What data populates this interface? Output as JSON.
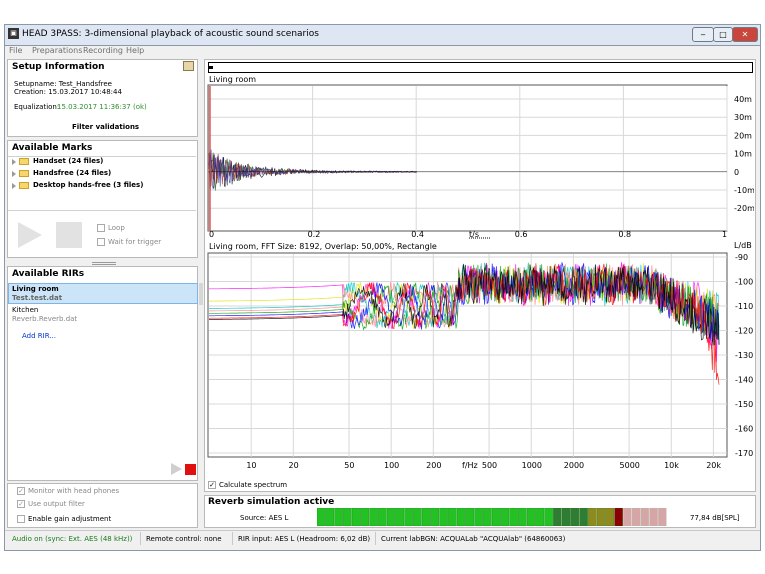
{
  "window": {
    "title": "HEAD 3PASS: 3-dimensional playback of acoustic sound scenarios",
    "app_icon": "bmp-icon",
    "controls": {
      "minimize": "‒",
      "maximize": "□",
      "close": "✕"
    }
  },
  "menu": [
    "File",
    "Preparations",
    "Recording",
    "Help"
  ],
  "setup": {
    "header": "Setup Information",
    "setupname": "Setupname: Test_Handsfree",
    "creation": "Creation: 15.03.2017 10:48:44",
    "equalization_label": "Equalization:",
    "equalization_value": "15.03.2017 11:36:37 (ok)",
    "filter_validations": "Filter validations"
  },
  "marks": {
    "header": "Available Marks",
    "items": [
      "Handset (24 files)",
      "Handsfree (24 files)",
      "Desktop hands-free (3 files)"
    ],
    "loop": "Loop",
    "wait_for_trigger": "Wait for trigger"
  },
  "rirs": {
    "header": "Available RIRs",
    "items": [
      {
        "name": "Living room",
        "file": "Test.test.dat"
      },
      {
        "name": "Kitchen",
        "file": "Reverb.Reverb.dat"
      }
    ],
    "add": "Add RIR..."
  },
  "bottom_options": {
    "monitor": "Monitor with head phones",
    "output_filter": "Use output filter",
    "gain": "Enable gain adjustment"
  },
  "time_chart": {
    "title": "Living room",
    "xlabel": "t/s",
    "xticks": [
      "0",
      "0.2",
      "0.4",
      "0.6",
      "0.8",
      "1"
    ],
    "yticks": [
      "40m",
      "30m",
      "20m",
      "10m",
      "0",
      "-10m",
      "-20m"
    ]
  },
  "spectrum_chart": {
    "title": "Living room, FFT Size: 8192, Overlap: 50,00%, Rectangle",
    "ylabel": "L/dB",
    "xlabel": "f/Hz",
    "xticks": [
      "10",
      "20",
      "50",
      "100",
      "200",
      "500",
      "1000",
      "2000",
      "5000",
      "10k",
      "20k"
    ],
    "yticks": [
      "-90",
      "-100",
      "-110",
      "-120",
      "-130",
      "-140",
      "-150",
      "-160",
      "-170"
    ]
  },
  "calculate_spectrum": "Calculate spectrum",
  "reverb": {
    "title": "Reverb simulation active",
    "source": "Source: AES L",
    "level": "77,84 dB[SPL]",
    "meter_fraction": 0.87
  },
  "status": {
    "audio": "Audio on (sync: Ext. AES (48 kHz))",
    "remote": "Remote control: none",
    "rir_input": "RIR input: AES L (Headroom: 6,02 dB)",
    "lab": "Current labBGN: ACQUALab \"ACQUAlab\" (64860063)"
  },
  "colors": {
    "equalization_ok": "#2f8f2f",
    "meter_green": "#23c223",
    "meter_dark_green": "#2e7d32",
    "meter_olive": "#8f8a1e",
    "meter_red": "#8b0000",
    "selection": "#cce4f7",
    "link": "#0033cc",
    "audio_on": "#1a7a1a"
  }
}
